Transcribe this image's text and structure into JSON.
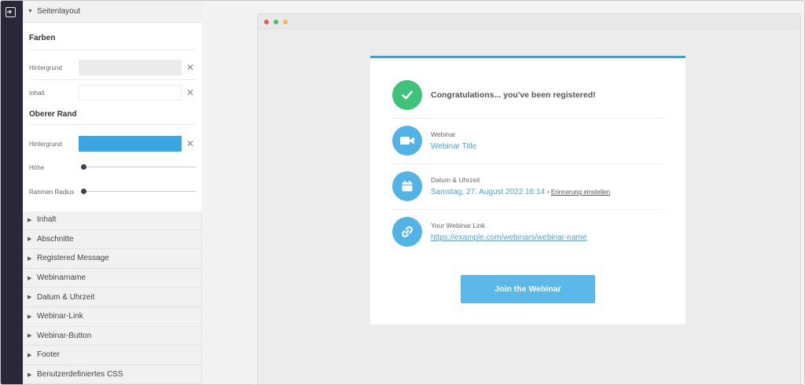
{
  "panel": {
    "layout_section": "Seitenlayout",
    "colors_group": "Farben",
    "background_label": "Hintergrund",
    "content_label": "Inhalt",
    "top_border_group": "Oberer Rand",
    "top_background_label": "Hintergrund",
    "height_label": "Höhe",
    "radius_label": "Rahmen Radius",
    "background_color": "#ebebec",
    "content_color": "#ffffff",
    "top_border_color": "#3aa6e3",
    "height_value_fraction": 0.02,
    "radius_value_fraction": 0.02,
    "sections": [
      "Inhalt",
      "Abschnitte",
      "Registered Message",
      "Webinarname",
      "Datum & Uhrzeit",
      "Webinar-Link",
      "Webinar-Button",
      "Footer",
      "Benutzerdefiniertes CSS"
    ]
  },
  "card": {
    "success_message": "Congratulations... you've been registered!",
    "webinar_label": "Webinar",
    "webinar_title": "Webinar Title",
    "datetime_label": "Datum & Uhrzeit",
    "datetime_value": "Samstag, 27. August 2022 16:14",
    "bullet": "•",
    "reminder_link": "Erinnerung einstellen",
    "link_label": "Your Webinar Link",
    "link_url": "https://example.com/webinars/webinar-name",
    "join_button": "Join the Webinar",
    "success_color": "#3fc27a",
    "accent_color": "#52b3e6"
  },
  "browser": {
    "dot_colors": [
      "#ee5b51",
      "#43c35a",
      "#f1bb3e"
    ]
  }
}
